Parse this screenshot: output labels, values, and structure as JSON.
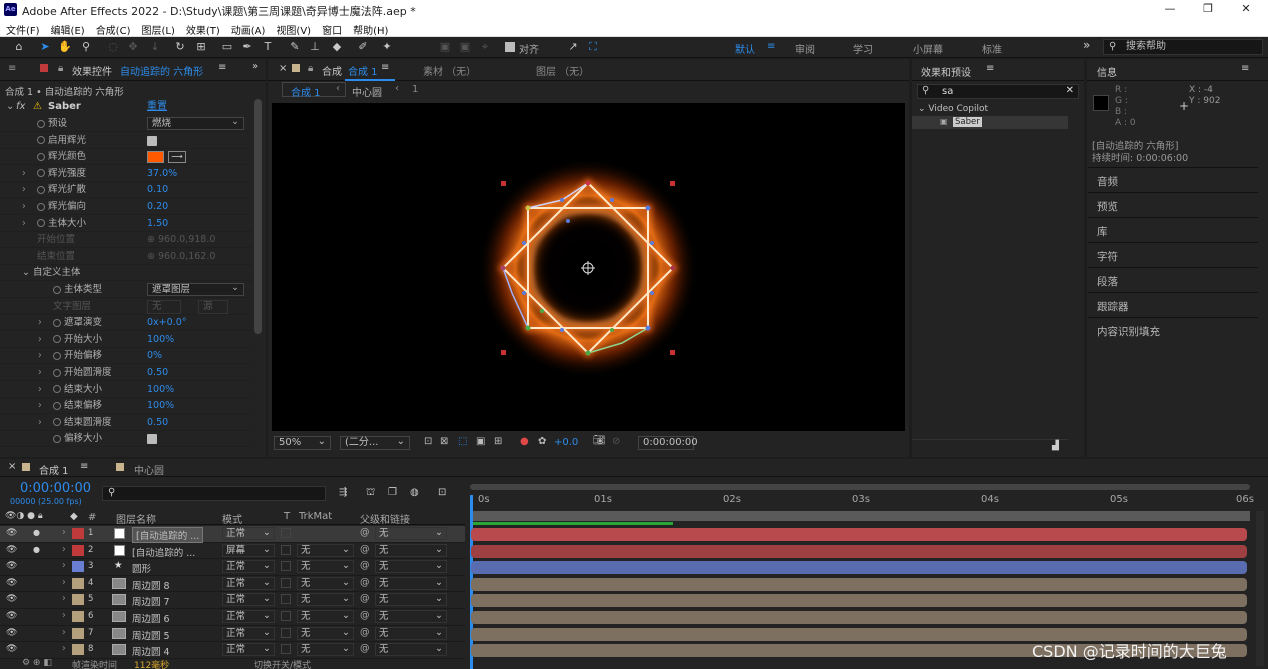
{
  "app": {
    "title": "Adobe After Effects 2022 - D:\\Study\\课题\\第三周课题\\奇异博士魔法阵.aep *",
    "logo": "Ae",
    "minimize": "—",
    "maximize": "❐",
    "close": "✕"
  },
  "menu": [
    "文件(F)",
    "编辑(E)",
    "合成(C)",
    "图层(L)",
    "效果(T)",
    "动画(A)",
    "视图(V)",
    "窗口",
    "帮助(H)"
  ],
  "toolbar": {
    "align_label": "对齐",
    "workspaces": [
      "默认",
      "≡",
      "审阅",
      "学习",
      "小屏幕",
      "标准"
    ],
    "more": "»",
    "help_placeholder": "搜索帮助"
  },
  "effects_panel": {
    "tab_prefix": "效果控件",
    "tab_layer": "自动追踪的 六角形",
    "breadcrumb": "合成 1 • 自动追踪的 六角形",
    "effect_name": "Saber",
    "reset": "重置",
    "rows": [
      {
        "label": "预设",
        "type": "dropdown",
        "value": "燃烧"
      },
      {
        "label": "启用辉光",
        "type": "check"
      },
      {
        "label": "辉光颜色",
        "type": "color",
        "color": "#ff5a00"
      },
      {
        "label": "辉光强度",
        "type": "value",
        "value": "37.0%"
      },
      {
        "label": "辉光扩散",
        "type": "value",
        "value": "0.10"
      },
      {
        "label": "辉光偏向",
        "type": "value",
        "value": "0.20"
      },
      {
        "label": "主体大小",
        "type": "value",
        "value": "1.50"
      },
      {
        "label": "开始位置",
        "type": "dim",
        "value": "960.0,918.0"
      },
      {
        "label": "结束位置",
        "type": "dim",
        "value": "960.0,162.0"
      },
      {
        "label": "自定义主体",
        "type": "group"
      },
      {
        "label": "主体类型",
        "type": "dropdown",
        "value": "遮罩图层"
      },
      {
        "label": "文字图层",
        "type": "dim2",
        "value": "无",
        "value2": "源"
      },
      {
        "label": "遮罩演变",
        "type": "value",
        "value": "0x+0.0°"
      },
      {
        "label": "开始大小",
        "type": "value",
        "value": "100%"
      },
      {
        "label": "开始偏移",
        "type": "value",
        "value": "0%"
      },
      {
        "label": "开始圆滑度",
        "type": "value",
        "value": "0.50"
      },
      {
        "label": "结束大小",
        "type": "value",
        "value": "100%"
      },
      {
        "label": "结束偏移",
        "type": "value",
        "value": "100%"
      },
      {
        "label": "结束圆滑度",
        "type": "value",
        "value": "0.50"
      },
      {
        "label": "偏移大小",
        "type": "check"
      }
    ]
  },
  "comp_panel": {
    "tab_prefix": "合成",
    "tab_comp": "合成 1",
    "footage_tab": "素材 （无）",
    "layer_tab": "图层 （无）",
    "nav_active": "合成 1",
    "nav_next": "中心圆",
    "nav_tail": "1",
    "zoom": "50%",
    "resolution": "(二分...",
    "exposure": "+0.0",
    "timecode": "0:00:00:00"
  },
  "effects_presets": {
    "title": "效果和预设",
    "search_value": "sa",
    "category": "Video Copilot",
    "item": "Saber"
  },
  "info_panel": {
    "title": "信息",
    "r": "R :",
    "g": "G :",
    "b": "B :",
    "a": "A : 0",
    "x": "X : -4",
    "y": "Y : 902",
    "layer": "[自动追踪的 六角形]",
    "duration": "持续时间: 0:00:06:00"
  },
  "side_panels": [
    "音频",
    "预览",
    "库",
    "字符",
    "段落",
    "跟踪器",
    "内容识别填充"
  ],
  "timeline": {
    "tab1": "合成 1",
    "tab2": "中心圆",
    "timecode": "0:00:00:00",
    "fps": "00000 (25.00 fps)",
    "search_placeholder": "",
    "col_name": "图层名称",
    "col_mode": "模式",
    "col_t": "T",
    "col_trkmat": "TrkMat",
    "col_parent": "父级和链接",
    "ruler": [
      "0s",
      "01s",
      "02s",
      "03s",
      "04s",
      "05s",
      "06s"
    ],
    "layers": [
      {
        "num": "1",
        "name": "[自动追踪的 ...",
        "mode": "正常",
        "trk": "",
        "parent": "无",
        "label_color": "#c0393b",
        "bar_color": "#b84a4d",
        "icon": "solid"
      },
      {
        "num": "2",
        "name": "[自动追踪的 ...",
        "mode": "屏幕",
        "trk": "无",
        "parent": "无",
        "label_color": "#c0393b",
        "bar_color": "#9e3f42",
        "icon": "solid"
      },
      {
        "num": "3",
        "name": "圆形",
        "mode": "正常",
        "trk": "无",
        "parent": "无",
        "label_color": "#6a7fd4",
        "bar_color": "#5a6cb0",
        "icon": "star"
      },
      {
        "num": "4",
        "name": "周边圆 8",
        "mode": "正常",
        "trk": "无",
        "parent": "无",
        "label_color": "#b4a07c",
        "bar_color": "#7d7060",
        "icon": "comp"
      },
      {
        "num": "5",
        "name": "周边圆 7",
        "mode": "正常",
        "trk": "无",
        "parent": "无",
        "label_color": "#b4a07c",
        "bar_color": "#7d7060",
        "icon": "comp"
      },
      {
        "num": "6",
        "name": "周边圆 6",
        "mode": "正常",
        "trk": "无",
        "parent": "无",
        "label_color": "#b4a07c",
        "bar_color": "#7d7060",
        "icon": "comp"
      },
      {
        "num": "7",
        "name": "周边圆 5",
        "mode": "正常",
        "trk": "无",
        "parent": "无",
        "label_color": "#b4a07c",
        "bar_color": "#7d7060",
        "icon": "comp"
      },
      {
        "num": "8",
        "name": "周边圆 4",
        "mode": "正常",
        "trk": "无",
        "parent": "无",
        "label_color": "#b4a07c",
        "bar_color": "#7d7060",
        "icon": "comp"
      }
    ],
    "footer_label": "帧渲染时间",
    "footer_value": "112毫秒",
    "footer_toggle": "切换开关/模式"
  },
  "watermark": "CSDN @记录时间的大巨兔"
}
